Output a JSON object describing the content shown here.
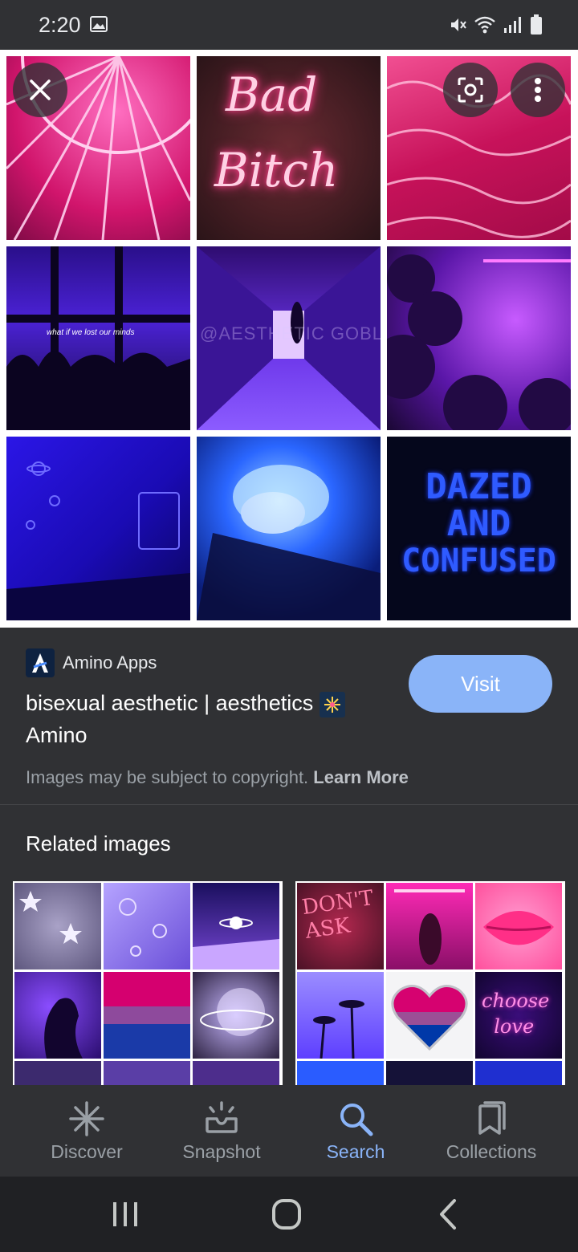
{
  "status_bar": {
    "time": "2:20",
    "icons": [
      "gallery-icon",
      "mute-icon",
      "wifi-icon",
      "signal-icon",
      "battery-icon"
    ]
  },
  "viewer": {
    "overlay_buttons": [
      "close-icon",
      "lens-icon",
      "more-vert-icon"
    ],
    "tiles": [
      {
        "name": "ferris-wheel-neon",
        "color": "#e0297a"
      },
      {
        "name": "bad-bitch-neon-sign",
        "color": "#3a1a1e",
        "text_line1": "Bad",
        "text_line2": "Bitch"
      },
      {
        "name": "pink-water",
        "color": "#d8195f"
      },
      {
        "name": "window-silhouettes",
        "color": "#3a14a0",
        "caption": "what if we lost our minds"
      },
      {
        "name": "purple-hallway",
        "color": "#5a2ad0",
        "watermark": "@AESTHETIC GOBLIN"
      },
      {
        "name": "purple-plants",
        "color": "#6a1fb0"
      },
      {
        "name": "blue-planets",
        "color": "#1d10c8"
      },
      {
        "name": "blue-succulent",
        "color": "#1e4ee0"
      },
      {
        "name": "dazed-and-confused-text",
        "color": "#0a0c2a",
        "text_lines": [
          "DAZED",
          "AND",
          "CONFUSED"
        ]
      }
    ]
  },
  "result": {
    "source_name": "Amino Apps",
    "title": "bisexual aesthetic | aesthetics 🎇 Amino",
    "title_text": "bisexual aesthetic | aesthetics",
    "title_line2": "Amino",
    "visit_label": "Visit",
    "copyright_text": "Images may be subject to copyright.",
    "learn_more": "Learn More"
  },
  "related": {
    "heading": "Related images"
  },
  "bottom_nav": [
    {
      "label": "Discover",
      "icon": "asterisk-icon",
      "active": false
    },
    {
      "label": "Snapshot",
      "icon": "snapshot-icon",
      "active": false
    },
    {
      "label": "Search",
      "icon": "search-icon",
      "active": true
    },
    {
      "label": "Collections",
      "icon": "collections-icon",
      "active": false
    }
  ],
  "system_nav": [
    "recents-icon",
    "home-icon",
    "back-icon"
  ],
  "colors": {
    "background": "#303134",
    "accent": "#8ab4f8",
    "system_nav": "#202124"
  }
}
